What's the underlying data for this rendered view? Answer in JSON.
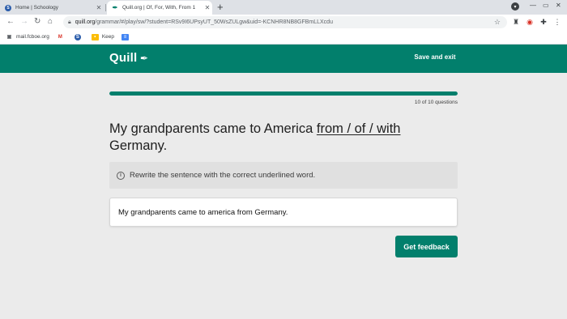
{
  "browser": {
    "tabs": [
      {
        "title": "Home | Schoology",
        "icon": "schoology-icon",
        "active": false
      },
      {
        "title": "Quill.org | Of, For, With, From 1",
        "icon": "quill-feather-icon",
        "active": true
      }
    ],
    "new_tab": "+",
    "url_host": "quill.org",
    "url_path": "/grammar/#/play/sw/?student=RSv9I6UPsyUT_50WsZULgw&uid=-KCNHR8NB8GFBmLLXcdu",
    "bookmarks": [
      {
        "label": "mail.fcboe.org",
        "icon": "folder-icon"
      },
      {
        "label": "",
        "icon": "gmail-icon"
      },
      {
        "label": "",
        "icon": "schoology-icon"
      },
      {
        "label": "Keep",
        "icon": "keep-icon"
      },
      {
        "label": "",
        "icon": "docs-icon"
      }
    ]
  },
  "header": {
    "logo": "Quill",
    "save_exit": "Save and exit"
  },
  "progress": {
    "current": 10,
    "total": 10,
    "fraction": 1.0,
    "label": "10 of 10 questions"
  },
  "prompt": {
    "before": "My grandparents came to America ",
    "underlined": "from / of / with",
    "after": " Germany."
  },
  "instructions": "Rewrite the sentence with the correct underlined word.",
  "answer": {
    "value": "My grandparents came to america from Germany."
  },
  "feedback_button": "Get feedback",
  "colors": {
    "brand": "#027f6c",
    "page_bg": "#ebebeb",
    "instructions_bg": "#e0e0e0"
  }
}
